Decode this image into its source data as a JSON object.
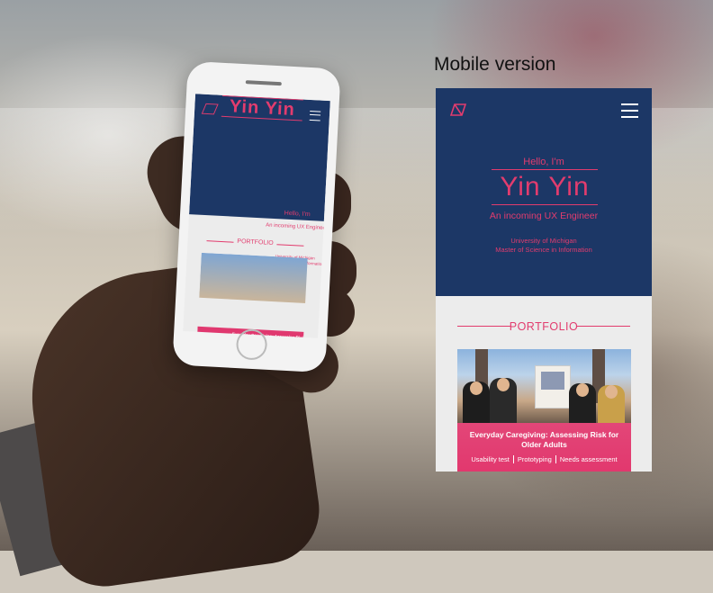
{
  "caption": "Mobile version",
  "hero": {
    "greeting": "Hello, I'm",
    "name": "Yin Yin",
    "role": "An incoming UX Engineer",
    "university": "University of Michigan",
    "degree": "Master of Science in Information"
  },
  "portfolio": {
    "title": "PORTFOLIO",
    "projects": [
      {
        "title": "Everyday Caregiving: Assessing Risk for Older Adults",
        "tags": [
          "Usability test",
          "Prototyping",
          "Needs assessment"
        ]
      }
    ]
  },
  "colors": {
    "navy": "#1c3766",
    "accent": "#e23c6e",
    "background": "#ececec"
  },
  "icons": {
    "logo": "logo-icon",
    "menu": "hamburger-menu-icon"
  }
}
